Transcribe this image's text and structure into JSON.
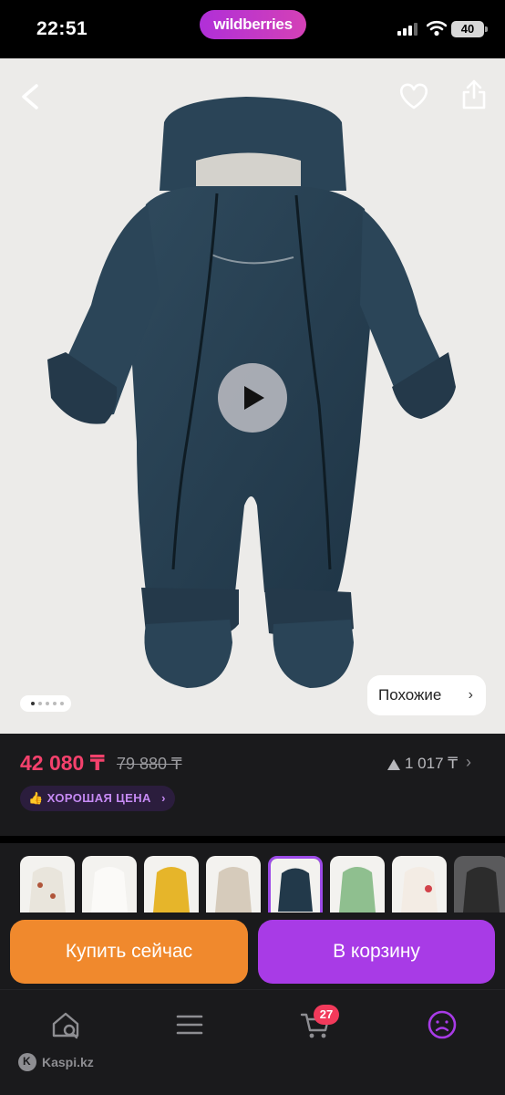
{
  "status_bar": {
    "time": "22:51",
    "brand": "wildberries",
    "battery": "40"
  },
  "gallery": {
    "similar_label": "Похожие",
    "icons": [
      "back-arrow-icon",
      "heart-icon",
      "share-icon",
      "play-icon",
      "chevron-right-icon"
    ],
    "dots_total": 5,
    "dots_active_index": 0
  },
  "price": {
    "current": "42 080 ₸",
    "old": "79 880 ₸",
    "reviews_count": "1 017 ₸",
    "good_price_label": "ХОРОШАЯ ЦЕНА",
    "colors": {
      "current": "#f4416c",
      "badge_text": "#c68af4"
    }
  },
  "variants": {
    "selected_index": 5,
    "swatches": [
      "#e9e5dc",
      "#f2efea",
      "#e6b52a",
      "#d6cbbb",
      "#22394a",
      "#8fbf8f",
      "#f3ece4",
      "#2c2c2c"
    ]
  },
  "actions": {
    "buy_now": "Купить сейчас",
    "add_to_cart": "В корзину",
    "colors": {
      "buy_now": "#f0892d",
      "add_to_cart": "#a83be6"
    }
  },
  "tabbar": {
    "items": [
      "home-search-icon",
      "menu-icon",
      "cart-icon",
      "profile-icon"
    ],
    "cart_badge": "27",
    "watermark": "Kaspi.kz"
  }
}
